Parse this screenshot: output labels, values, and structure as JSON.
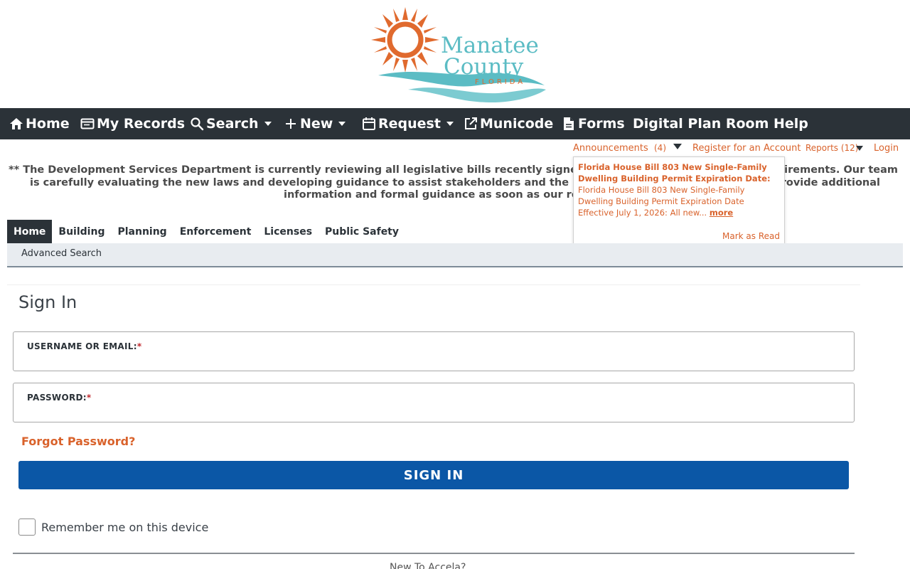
{
  "logo": {
    "line1": "Manatee",
    "line2": "County",
    "line3": "FLORIDA"
  },
  "topnav": {
    "home": "Home",
    "my_records": "My Records",
    "search": "Search",
    "new": "New",
    "request": "Request",
    "municode": "Municode",
    "forms": "Forms",
    "help": "Digital Plan Room Help"
  },
  "utility": {
    "announcements": "Announcements",
    "announcement_count": "(4)",
    "register": "Register for an Account",
    "reports": "Reports (12)",
    "login": "Login"
  },
  "notice": {
    "line1": "** The Development Services Department is currently reviewing all legislative bills recently signed by the Governor",
    "line1_end": "requirements. Our team",
    "line2": "is carefully evaluating the new laws and developing guidance to assist stakeholders and the public. We apprecia",
    "line2_end": "l provide additional",
    "line3": "information and formal guidance as soon as our review is co"
  },
  "announcement_popup": {
    "title": "Florida House Bill 803 New Single-Family Dwelling Building Permit Expiration Date:",
    "body": " Florida House Bill 803 New Single-Family Dwelling Building Permit Expiration Date Effective July 1, 2026: All new... ",
    "more": "more",
    "mark_read": "Mark as Read"
  },
  "tabs": [
    "Home",
    "Building",
    "Planning",
    "Enforcement",
    "Licenses",
    "Public Safety"
  ],
  "subnav": {
    "advanced_search": "Advanced Search"
  },
  "signin": {
    "title": "Sign In",
    "username_label": "USERNAME OR EMAIL:",
    "password_label": "PASSWORD:",
    "required_mark": "*",
    "forgot": "Forgot Password?",
    "button": "SIGN IN",
    "remember": "Remember me on this device",
    "new_user": "New To Accela?"
  },
  "colors": {
    "nav_bg": "#2b3238",
    "accent_orange": "#d9622b",
    "button_blue": "#0b57a6",
    "logo_teal": "#5bbcc4",
    "logo_sun": "#e06a2e"
  }
}
